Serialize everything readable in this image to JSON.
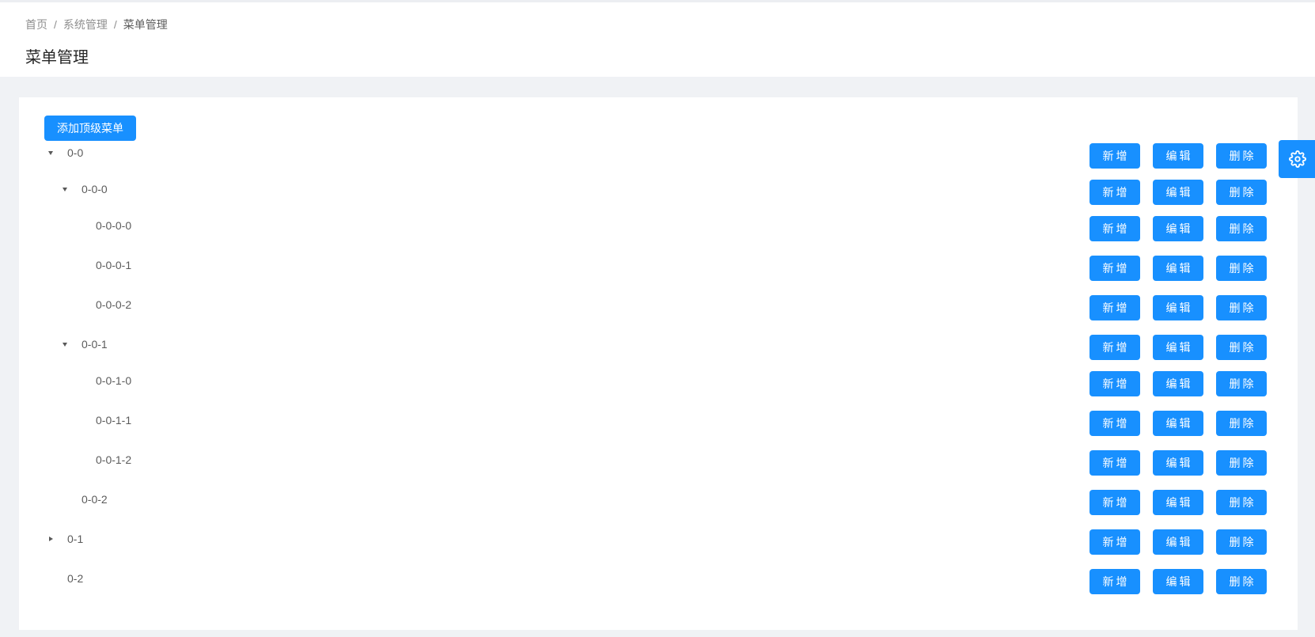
{
  "breadcrumb": {
    "items": [
      "首页",
      "系统管理",
      "菜单管理"
    ],
    "separator": "/"
  },
  "page_title": "菜单管理",
  "add_top_button": "添加顶级菜单",
  "action_labels": {
    "add": "新增",
    "edit": "编辑",
    "delete": "删除"
  },
  "tree": [
    {
      "title": "0-0",
      "level": 0,
      "switcher": "expanded"
    },
    {
      "title": "0-0-0",
      "level": 1,
      "switcher": "expanded"
    },
    {
      "title": "0-0-0-0",
      "level": 2,
      "switcher": "none"
    },
    {
      "title": "0-0-0-1",
      "level": 2,
      "switcher": "none"
    },
    {
      "title": "0-0-0-2",
      "level": 2,
      "switcher": "none"
    },
    {
      "title": "0-0-1",
      "level": 1,
      "switcher": "expanded"
    },
    {
      "title": "0-0-1-0",
      "level": 2,
      "switcher": "none"
    },
    {
      "title": "0-0-1-1",
      "level": 2,
      "switcher": "none"
    },
    {
      "title": "0-0-1-2",
      "level": 2,
      "switcher": "none"
    },
    {
      "title": "0-0-2",
      "level": 1,
      "switcher": "none"
    },
    {
      "title": "0-1",
      "level": 0,
      "switcher": "collapsed"
    },
    {
      "title": "0-2",
      "level": 0,
      "switcher": "none"
    }
  ],
  "colors": {
    "primary": "#1890ff",
    "background": "#f0f2f5"
  },
  "icons": {
    "settings": "gear-icon"
  }
}
